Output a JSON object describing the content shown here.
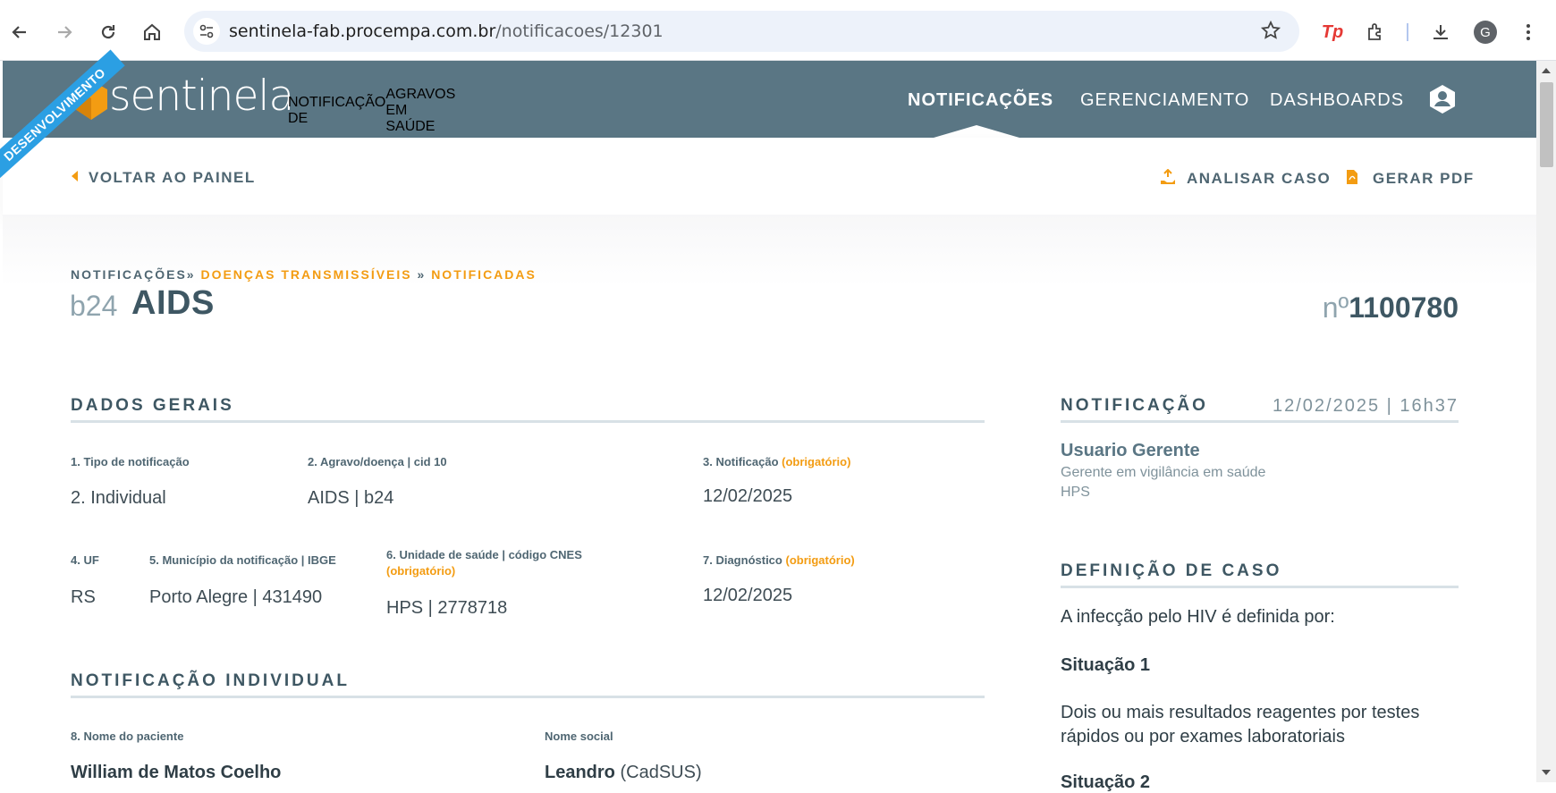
{
  "browser": {
    "url_host": "sentinela-fab.procempa.com.br",
    "url_path": "/notificacoes/12301",
    "avatar_letter": "G",
    "extension_badge": "Tp",
    "icons": [
      "back-icon",
      "forward-icon",
      "reload-icon",
      "home-icon",
      "site-info-icon",
      "star-icon",
      "extensions-icon",
      "download-icon",
      "menu-icon"
    ]
  },
  "header": {
    "ribbon": "DESENVOLVIMENTO",
    "logo_text": "sentinela",
    "tagline_line1": "NOTIFICAÇÃO DE",
    "tagline_line2": "AGRAVOS EM SAÚDE",
    "nav": [
      {
        "label": "NOTIFICAÇÕES",
        "active": true
      },
      {
        "label": "GERENCIAMENTO",
        "active": false
      },
      {
        "label": "DASHBOARDS",
        "active": false
      }
    ],
    "brand_color": "#5a7684",
    "accent_color": "#f39c12"
  },
  "subbar": {
    "back_label": "VOLTAR AO PAINEL",
    "analyze_label": "ANALISAR CASO",
    "pdf_label": "GERAR PDF"
  },
  "breadcrumb": {
    "root": "NOTIFICAÇÕES",
    "sep1": "»",
    "level1": "DOENÇAS TRANSMISSÍVEIS",
    "sep2": "»",
    "level2": "NOTIFICADAS"
  },
  "title": {
    "cid": "b24",
    "name": "AIDS",
    "number_prefix": "nº",
    "number": "1100780"
  },
  "dados_gerais": {
    "heading": "DADOS GERAIS",
    "required_tag": "(obrigatório)",
    "fields": {
      "tipo_label": "1. Tipo de notificação",
      "tipo_value": "2. Individual",
      "agravo_label": "2. Agravo/doença | cid 10",
      "agravo_value": "AIDS | b24",
      "notificacao_label": "3. Notificação",
      "notificacao_value": "12/02/2025",
      "uf_label": "4. UF",
      "uf_value": "RS",
      "municipio_label": "5. Município da notificação | IBGE",
      "municipio_value": "Porto Alegre | 431490",
      "unidade_label": "6. Unidade de saúde | código CNES",
      "unidade_value": "HPS | 2778718",
      "diagnostico_label": "7. Diagnóstico",
      "diagnostico_value": "12/02/2025"
    }
  },
  "notificacao_individual": {
    "heading": "NOTIFICAÇÃO INDIVIDUAL",
    "nome_label": "8. Nome do paciente",
    "nome_value": "William de Matos Coelho",
    "social_label": "Nome social",
    "social_value": "Leandro",
    "social_source": "(CadSUS)"
  },
  "side": {
    "heading": "NOTIFICAÇÃO",
    "date": "12/02/2025 | 16h37",
    "user_name": "Usuario Gerente",
    "user_role": "Gerente em vigilância em saúde",
    "user_unit": "HPS",
    "case_heading": "DEFINIÇÃO DE CASO",
    "case_intro": "A infecção pelo HIV é definida por:",
    "situacao1": "Situação 1",
    "situacao1_text_line1": "Dois ou mais resultados reagentes por testes",
    "situacao1_text_line2": "rápidos ou por exames laboratoriais",
    "situacao2": "Situação 2"
  }
}
